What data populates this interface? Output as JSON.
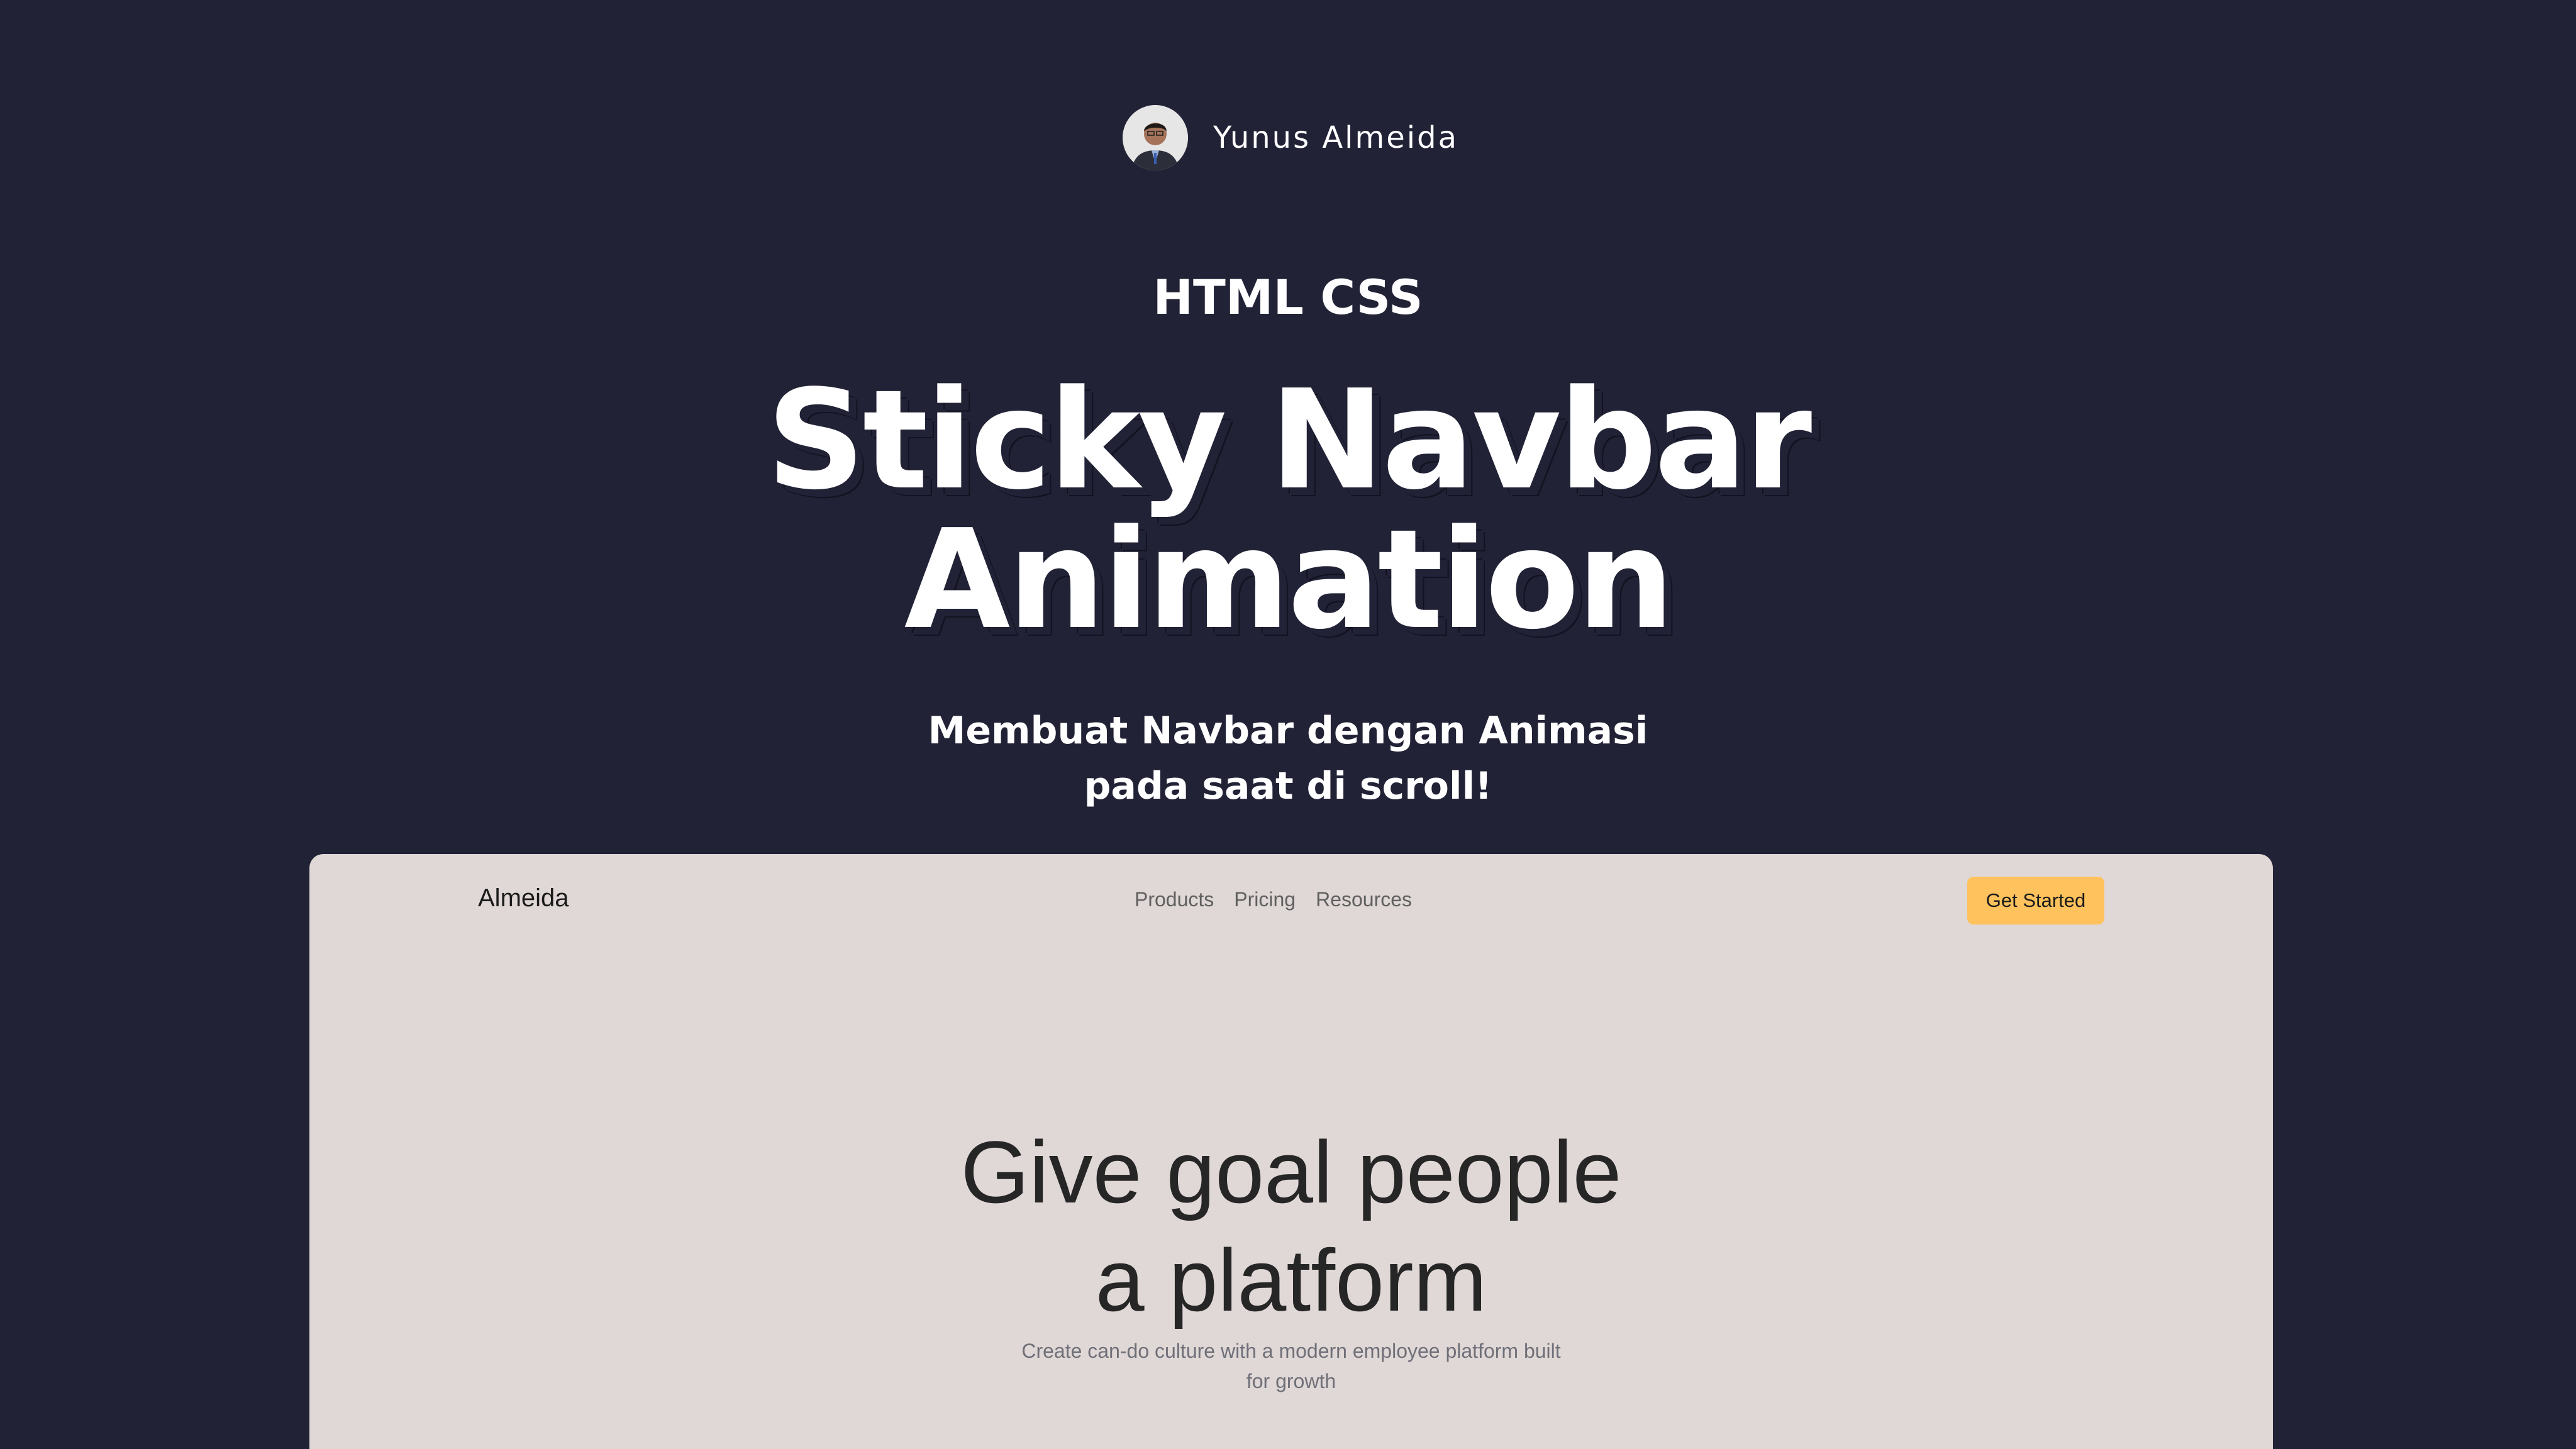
{
  "author": {
    "name": "Yunus Almeida",
    "avatar_icon": "profile-photo"
  },
  "hero": {
    "kicker": "HTML CSS",
    "title_line1": "Sticky Navbar",
    "title_line2": "Animation",
    "subtitle": "Membuat Navbar dengan Animasi pada saat di scroll!"
  },
  "preview": {
    "brand": "Almeida",
    "nav_links": [
      "Products",
      "Pricing",
      "Resources"
    ],
    "cta_label": "Get Started",
    "hero_title_line1": "Give goal people",
    "hero_title_line2": "a platform",
    "hero_subtitle": "Create can-do culture with a modern employee platform built for growth"
  },
  "colors": {
    "background": "#222237",
    "preview_background": "#e0d8d6",
    "cta": "#ffc25c",
    "text_light": "#ffffff",
    "text_dark": "#262626"
  }
}
